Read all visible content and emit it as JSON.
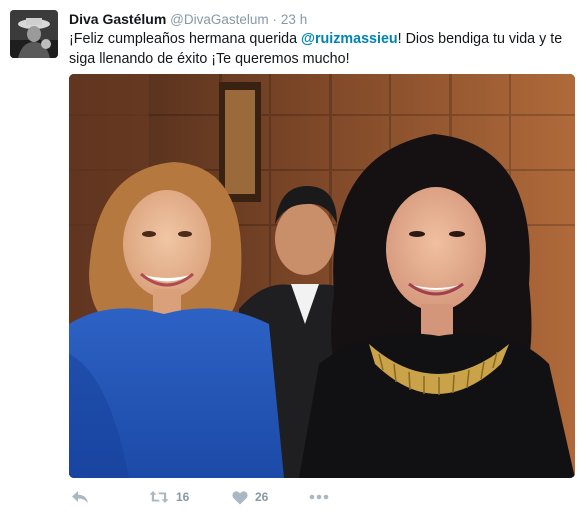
{
  "tweet": {
    "author": {
      "display_name": "Diva Gastélum",
      "handle": "@DivaGastelum",
      "separator": "·",
      "time": "23 h"
    },
    "text_before": "¡Feliz cumpleaños hermana querida ",
    "mention": "@ruizmassieu",
    "text_after": "! Dios bendiga tu vida y te siga llenando de éxito ¡Te queremos mucho!",
    "actions": {
      "reply_icon": "reply-icon",
      "retweet_icon": "retweet-icon",
      "retweet_count": "16",
      "like_icon": "heart-icon",
      "like_count": "26",
      "more_icon": "more-icon"
    },
    "colors": {
      "link": "#0084b4",
      "muted": "#8899a6",
      "text": "#14171a"
    }
  }
}
